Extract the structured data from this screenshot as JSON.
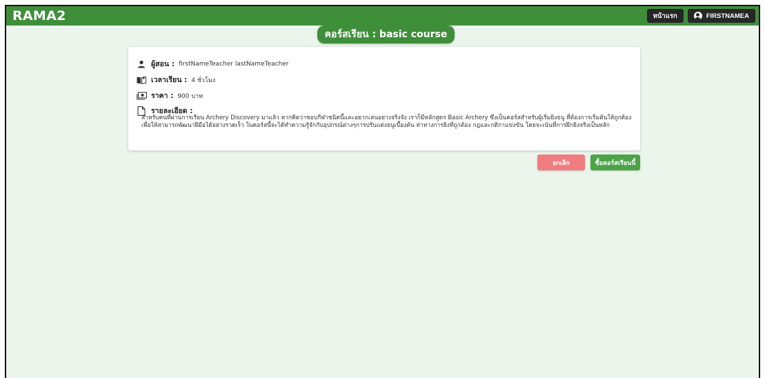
{
  "app": {
    "brand": "RAMA2"
  },
  "nav": {
    "home_label": "หน้าแรก",
    "user_label": "FIRSTNAMEA"
  },
  "course": {
    "title": "คอร์สเรียน : basic course",
    "teacher_label": "ผู้สอน :",
    "teacher_value": "firstNameTeacher lastNameTeacher",
    "duration_label": "เวลาเรียน :",
    "duration_value": "4 ชั่วโมง",
    "price_label": "ราคา :",
    "price_value": "900 บาท",
    "detail_label": "รายละเอียด :",
    "detail_text": "สำหรับคนที่ผ่านการเรียน Archery Discovery มาแล้ว หากคิดว่าชอบกีฬาชนิดนี้และอยากเล่นอย่างจริงจัง เราก็มีหลักสูตร Basic Archery ซึ่งเป็นคอร์สสำหรับผู้เริ่มยิงธนู ที่ต้องการเริ่มต้นให้ถูกต้องเพื่อให้สามารถพัฒนาฝีมือได้อย่างรวดเร็ว ในคอร์สนี้จะได้ทำความรู้จักกับอุปกรณ์ต่างๆการปรับแต่งธนูเบื้องต้น ท่าทางการยิงที่ถูกต้อง กฎและกติกาแข่งขัน โดยจะเน้นที่การฝึกยิงจริงเป็นหลัก"
  },
  "actions": {
    "cancel_label": "ยกเลิก",
    "buy_label": "ซื้อคอร์สเรียนนี้"
  },
  "colors": {
    "primary": "#3f8f3a",
    "background": "#ebf5ec",
    "cancel": "#ef7c7f",
    "buy": "#4aa445",
    "nav_button": "#262626"
  },
  "icons": {
    "teacher": "person-icon",
    "duration": "book-icon",
    "price": "money-icon",
    "detail": "document-icon",
    "user": "user-circle-icon"
  }
}
